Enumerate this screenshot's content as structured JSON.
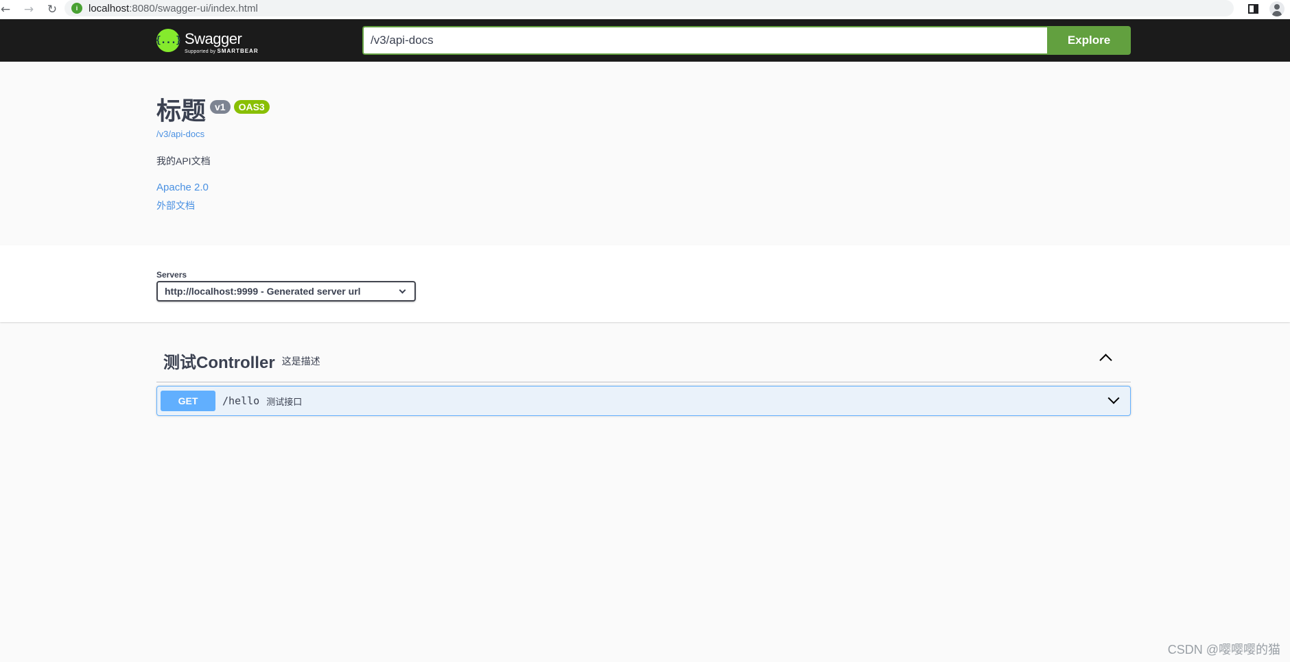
{
  "browser": {
    "url_host": "localhost",
    "url_path": ":8080/swagger-ui/index.html",
    "icons": [
      "back-icon",
      "forward-icon",
      "reload-icon",
      "site-info-icon",
      "side-panel-icon",
      "profile-icon"
    ]
  },
  "topbar": {
    "logo_mark": "{...}",
    "logo_title": "Swagger",
    "logo_sub_prefix": "Supported by ",
    "logo_sub_brand": "SMARTBEAR",
    "explore_value": "/v3/api-docs",
    "explore_label": "Explore"
  },
  "info": {
    "title": "标题",
    "version": "v1",
    "oas": "OAS3",
    "spec_url": "/v3/api-docs",
    "description": "我的API文档",
    "license": "Apache 2.0",
    "external_docs": "外部文档"
  },
  "servers": {
    "label": "Servers",
    "selected": "http://localhost:9999 - Generated server url"
  },
  "tag": {
    "name": "测试Controller",
    "description": "这是描述"
  },
  "operation": {
    "method": "GET",
    "path": "/hello",
    "summary": "测试接口"
  },
  "watermark": "CSDN @嘤嘤嘤的猫",
  "colors": {
    "topbar_bg": "#1b1b1b",
    "explore_green": "#62a03f",
    "get_blue": "#61affe",
    "link_blue": "#4990e2",
    "version_gray": "#7d8492",
    "oas_green": "#89bf04"
  }
}
